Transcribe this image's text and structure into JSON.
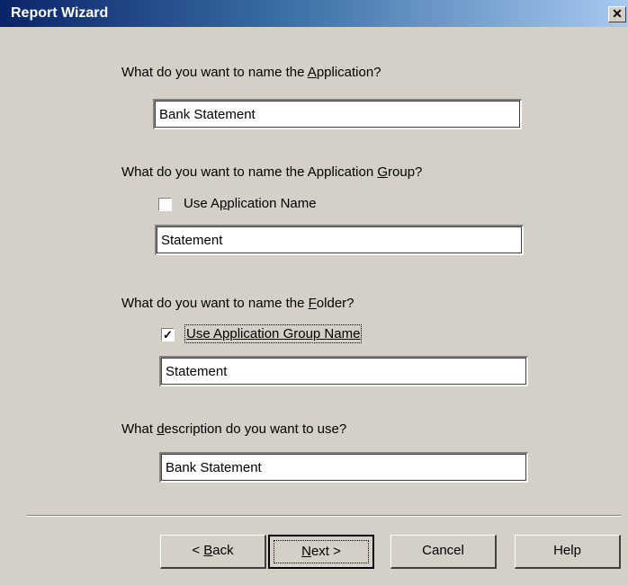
{
  "window": {
    "title": "Report Wizard",
    "close_glyph": "✕"
  },
  "application": {
    "question_pre": "What do you want to name the ",
    "question_key": "A",
    "question_post": "pplication?",
    "value": "Bank Statement"
  },
  "group": {
    "question_pre": "What do you want to name the Application ",
    "question_key": "G",
    "question_post": "roup?",
    "checkbox_pre": "Use A",
    "checkbox_key": "p",
    "checkbox_post": "plication Name",
    "checked": false,
    "value": "Statement"
  },
  "folder": {
    "question_pre": "What do you want to name the ",
    "question_key": "F",
    "question_post": "older?",
    "checkbox_label": "Use Application Group Name",
    "checked": true,
    "check_glyph": "✓",
    "value": "Statement"
  },
  "description": {
    "question_pre": "What ",
    "question_key": "d",
    "question_post": "escription do you want to use?",
    "value": "Bank Statement"
  },
  "buttons": {
    "back_pre": "< ",
    "back_key": "B",
    "back_post": "ack",
    "next_key": "N",
    "next_post": "ext >",
    "cancel": "Cancel",
    "help": "Help"
  }
}
